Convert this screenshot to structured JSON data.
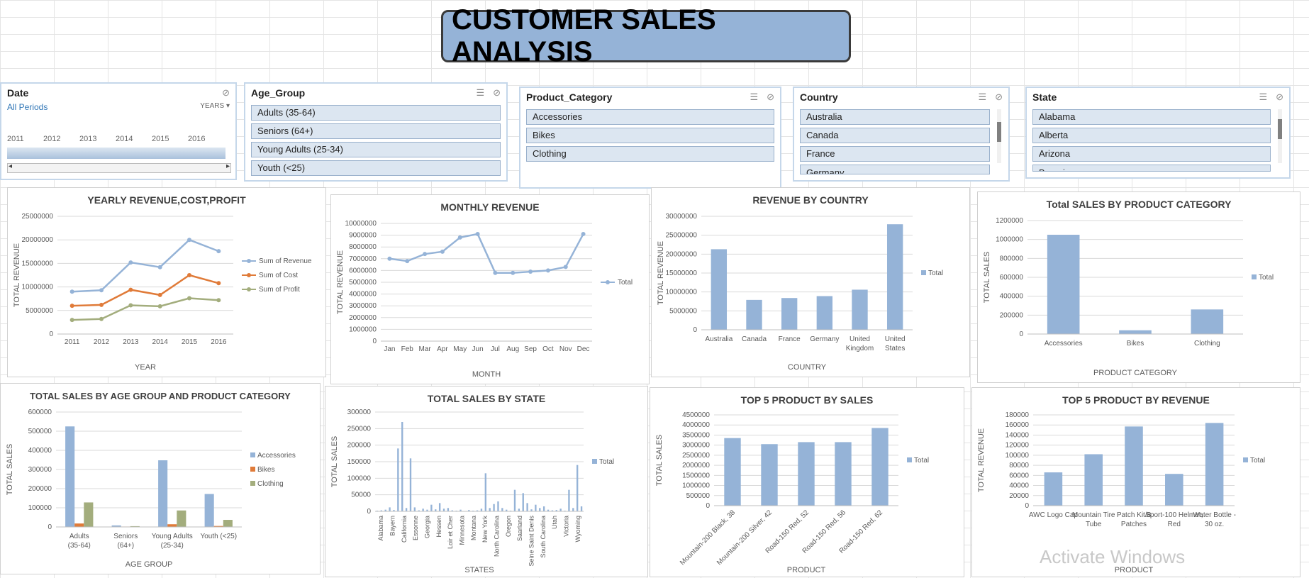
{
  "title": "CUSTOMER SALES ANALYSIS",
  "slicers": {
    "date": {
      "label": "Date",
      "period": "All Periods",
      "unit": "YEARS",
      "years": [
        "2011",
        "2012",
        "2013",
        "2014",
        "2015",
        "2016"
      ]
    },
    "age_group": {
      "label": "Age_Group",
      "items": [
        "Adults (35-64)",
        "Seniors (64+)",
        "Young Adults (25-34)",
        "Youth (<25)"
      ]
    },
    "product_category": {
      "label": "Product_Category",
      "items": [
        "Accessories",
        "Bikes",
        "Clothing"
      ]
    },
    "country": {
      "label": "Country",
      "items": [
        "Australia",
        "Canada",
        "France",
        "Germany"
      ]
    },
    "state": {
      "label": "State",
      "items": [
        "Alabama",
        "Alberta",
        "Arizona",
        "Bavaria"
      ]
    }
  },
  "watermark": "Activate Windows",
  "colors": {
    "blue": "#95b3d7",
    "orange": "#e07b39",
    "green": "#a3ad7d",
    "header": "#95b3d7"
  },
  "chart_data": [
    {
      "id": "yearly",
      "type": "line",
      "title": "YEARLY REVENUE,COST,PROFIT",
      "xlabel": "YEAR",
      "ylabel": "TOTAL REVENUE",
      "categories": [
        "2011",
        "2012",
        "2013",
        "2014",
        "2015",
        "2016"
      ],
      "ylim": [
        0,
        25000000
      ],
      "yticks": [
        0,
        5000000,
        10000000,
        15000000,
        20000000,
        25000000
      ],
      "series": [
        {
          "name": "Sum of Revenue",
          "color": "#95b3d7",
          "values": [
            9000000,
            9300000,
            15200000,
            14200000,
            20000000,
            17600000
          ]
        },
        {
          "name": "Sum of Cost",
          "color": "#e07b39",
          "values": [
            6000000,
            6200000,
            9400000,
            8300000,
            12500000,
            10800000
          ]
        },
        {
          "name": "Sum of Profit",
          "color": "#a3ad7d",
          "values": [
            3000000,
            3200000,
            6100000,
            5900000,
            7600000,
            7200000
          ]
        }
      ],
      "legend": "right"
    },
    {
      "id": "monthly",
      "type": "line",
      "title": "MONTHLY REVENUE",
      "xlabel": "MONTH",
      "ylabel": "TOTAL REVENUE",
      "categories": [
        "Jan",
        "Feb",
        "Mar",
        "Apr",
        "May",
        "Jun",
        "Jul",
        "Aug",
        "Sep",
        "Oct",
        "Nov",
        "Dec"
      ],
      "ylim": [
        0,
        10000000
      ],
      "yticks": [
        0,
        1000000,
        2000000,
        3000000,
        4000000,
        5000000,
        6000000,
        7000000,
        8000000,
        9000000,
        10000000
      ],
      "series": [
        {
          "name": "Total",
          "color": "#95b3d7",
          "values": [
            7000000,
            6800000,
            7400000,
            7600000,
            8800000,
            9100000,
            5800000,
            5800000,
            5900000,
            6000000,
            6300000,
            9100000
          ]
        }
      ],
      "legend": "right"
    },
    {
      "id": "country",
      "type": "bar",
      "title": "REVENUE BY COUNTRY",
      "xlabel": "COUNTRY",
      "ylabel": "TOTAL REVENUE",
      "categories": [
        "Australia",
        "Canada",
        "France",
        "Germany",
        "United Kingdom",
        "United States"
      ],
      "ylim": [
        0,
        30000000
      ],
      "yticks": [
        0,
        5000000,
        10000000,
        15000000,
        20000000,
        25000000,
        30000000
      ],
      "series": [
        {
          "name": "Total",
          "color": "#95b3d7",
          "values": [
            21300000,
            7900000,
            8400000,
            8900000,
            10600000,
            27900000
          ]
        }
      ],
      "legend": "right"
    },
    {
      "id": "category",
      "type": "bar",
      "title": "Total SALES BY PRODUCT CATEGORY",
      "xlabel": "PRODUCT CATEGORY",
      "ylabel": "TOTAL SALES",
      "categories": [
        "Accessories",
        "Bikes",
        "Clothing"
      ],
      "ylim": [
        0,
        1200000
      ],
      "yticks": [
        0,
        200000,
        400000,
        600000,
        800000,
        1000000,
        1200000
      ],
      "series": [
        {
          "name": "Total",
          "color": "#95b3d7",
          "values": [
            1050000,
            40000,
            260000
          ]
        }
      ],
      "legend": "right"
    },
    {
      "id": "agegroup",
      "type": "bar",
      "title": "TOTAL SALES BY AGE GROUP AND PRODUCT CATEGORY",
      "xlabel": "AGE GROUP",
      "ylabel": "TOTAL SALES",
      "categories": [
        "Adults (35-64)",
        "Seniors (64+)",
        "Young Adults (25-34)",
        "Youth (<25)"
      ],
      "ylim": [
        0,
        600000
      ],
      "yticks": [
        0,
        100000,
        200000,
        300000,
        400000,
        500000,
        600000
      ],
      "series": [
        {
          "name": "Accessories",
          "color": "#95b3d7",
          "values": [
            525000,
            8000,
            348000,
            172000
          ]
        },
        {
          "name": "Bikes",
          "color": "#e07b39",
          "values": [
            18000,
            2000,
            14000,
            5000
          ]
        },
        {
          "name": "Clothing",
          "color": "#a3ad7d",
          "values": [
            128000,
            4000,
            86000,
            37000
          ]
        }
      ],
      "legend": "right"
    },
    {
      "id": "state",
      "type": "bar",
      "title": "TOTAL SALES BY STATE",
      "xlabel": "STATES",
      "ylabel": "TOTAL SALES",
      "categories": [
        "Alabama",
        "Bayern",
        "California",
        "Essonne",
        "Georgia",
        "Hessen",
        "Loir et Cher",
        "Minnesota",
        "Montana",
        "New York",
        "North Carolina",
        "Oregon",
        "Saarland",
        "Seine Saint Denis",
        "South Carolina",
        "Utah",
        "Victoria",
        "Wyoming"
      ],
      "ylim": [
        0,
        300000
      ],
      "yticks": [
        0,
        50000,
        100000,
        150000,
        200000,
        250000,
        300000
      ],
      "series": [
        {
          "name": "Total",
          "color": "#95b3d7",
          "values": [
            2000,
            3000,
            5000,
            12000,
            4000,
            190000,
            270000,
            10000,
            160000,
            12000,
            3000,
            8000,
            5000,
            20000,
            6000,
            25000,
            8000,
            10000,
            3000,
            2000,
            5000,
            1000,
            4000,
            2000,
            3000,
            8000,
            115000,
            10000,
            22000,
            30000,
            10000,
            5000,
            2000,
            65000,
            8000,
            55000,
            25000,
            6000,
            20000,
            10000,
            15000,
            5000,
            3000,
            4000,
            8000,
            2000,
            65000,
            10000,
            140000,
            15000
          ]
        }
      ],
      "legend": "right"
    },
    {
      "id": "top5sales",
      "type": "bar",
      "title": "TOP 5 PRODUCT BY SALES",
      "xlabel": "PRODUCT",
      "ylabel": "TOTAL SALES",
      "categories": [
        "Mountain-200 Black, 38",
        "Mountain-200 Silver, 42",
        "Road-150 Red, 52",
        "Road-150 Red, 56",
        "Road-150 Red, 62"
      ],
      "ylim": [
        0,
        4500000
      ],
      "yticks": [
        0,
        500000,
        1000000,
        1500000,
        2000000,
        2500000,
        3000000,
        3500000,
        4000000,
        4500000
      ],
      "series": [
        {
          "name": "Total",
          "color": "#95b3d7",
          "values": [
            3350000,
            3050000,
            3150000,
            3150000,
            3850000
          ]
        }
      ],
      "legend": "right"
    },
    {
      "id": "top5revenue",
      "type": "bar",
      "title": "TOP 5 PRODUCT BY REVENUE",
      "xlabel": "PRODUCT",
      "ylabel": "TOTAL REVENUE",
      "categories": [
        "AWC Logo Cap",
        "Mountain Tire Tube",
        "Patch Kit/8 Patches",
        "Sport-100 Helmet, Red",
        "Water Bottle - 30 oz."
      ],
      "ylim": [
        0,
        180000
      ],
      "yticks": [
        0,
        20000,
        40000,
        60000,
        80000,
        100000,
        120000,
        140000,
        160000,
        180000
      ],
      "series": [
        {
          "name": "Total",
          "color": "#95b3d7",
          "values": [
            66000,
            102000,
            157000,
            63000,
            164000
          ]
        }
      ],
      "legend": "right"
    }
  ]
}
